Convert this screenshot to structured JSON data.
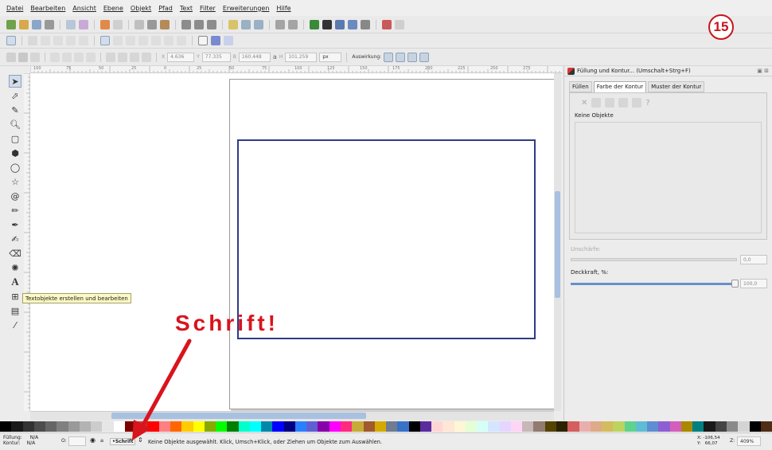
{
  "menu": [
    "Datei",
    "Bearbeiten",
    "Ansicht",
    "Ebene",
    "Objekt",
    "Pfad",
    "Text",
    "Filter",
    "Erweiterungen",
    "Hilfe"
  ],
  "step_badge": "15",
  "controls": {
    "x": "4.636",
    "y": "77.335",
    "w": "160.448",
    "h": "101.259",
    "lock_symbol": "a",
    "unit": "px",
    "auswirkung_label": "Auswirkung:",
    "ruler_labels": [
      "100",
      "75",
      "50",
      "25",
      "0",
      "25",
      "50",
      "75",
      "100",
      "125",
      "150",
      "175",
      "200",
      "225",
      "250",
      "275"
    ]
  },
  "tooltip": "Textobjekte erstellen und bearbeiten",
  "annotation": "Schrift!",
  "panel": {
    "title": "Füllung und Kontur... (Umschalt+Strg+F)",
    "tabs": [
      "Füllen",
      "Farbe der Kontur",
      "Muster der Kontur"
    ],
    "type_symbol": "?",
    "empty_text": "Keine Objekte",
    "blur_label": "Unschärfe:",
    "blur_value": "0,0",
    "opacity_label": "Deckkraft, %:",
    "opacity_value": "100,0"
  },
  "status": {
    "fill_label": "Füllung:",
    "fill_value": "N/A",
    "stroke_label": "Kontur:",
    "stroke_value": "N/A",
    "opacity_label": "O:",
    "layer": "•Schrift",
    "message": "Keine Objekte ausgewählt. Klick, Umsch+Klick, oder Ziehen um Objekte zum Auswählen.",
    "x_coord": "X: -106,54",
    "y_coord": "Y:   66,07",
    "zoom_label": "Z:",
    "zoom": "409%"
  },
  "colors": {
    "accent": "#d8141d",
    "rect_stroke": "#2e3c88",
    "tooltip_bg": "#fbf9c4",
    "palette": [
      "#000000",
      "#1a1a1a",
      "#333333",
      "#4d4d4d",
      "#666666",
      "#808080",
      "#999999",
      "#b3b3b3",
      "#cccccc",
      "#e6e6e6",
      "#ffffff",
      "#800000",
      "#c83737",
      "#ff0000",
      "#ff8080",
      "#ff6600",
      "#ffcc00",
      "#ffff00",
      "#88aa00",
      "#00ff00",
      "#008000",
      "#00ffcc",
      "#00ffff",
      "#0088aa",
      "#0000ff",
      "#000080",
      "#2a7fff",
      "#5f5fd3",
      "#8800aa",
      "#ff00ff",
      "#ff2a7f",
      "#c8ab37",
      "#a05a2c",
      "#d4aa00",
      "#6f7c91",
      "#3771c8",
      "#000000",
      "#5a2ca0",
      "#ffd5d5",
      "#ffe6d5",
      "#fff6d5",
      "#e5ffd5",
      "#d5fff6",
      "#d5e5ff",
      "#e5d5ff",
      "#ffd5f6",
      "#c8b7b7",
      "#917c6f",
      "#554400",
      "#2b2200",
      "#d35f5f",
      "#e9afaf",
      "#deaa87",
      "#d3bc5f",
      "#bcd35f",
      "#5fd38d",
      "#5fbcd3",
      "#5f8dd3",
      "#8d5fd3",
      "#d35fbc",
      "#aa8800",
      "#008080",
      "#1a1a1a",
      "#444444",
      "#8a8a8a",
      "#d4d4d4",
      "#000000",
      "#502d16"
    ]
  }
}
